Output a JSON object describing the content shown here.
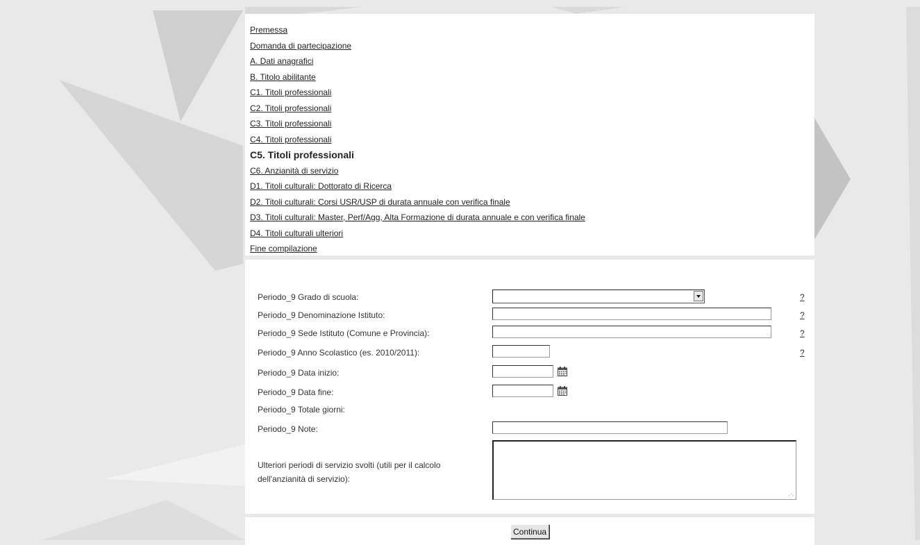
{
  "nav": {
    "items": [
      {
        "label": "Premessa"
      },
      {
        "label": "Domanda di partecipazione"
      },
      {
        "label": "A. Dati anagrafici"
      },
      {
        "label": "B. Titolo abilitante"
      },
      {
        "label": "C1. Titoli professionali"
      },
      {
        "label": "C2. Titoli professionali"
      },
      {
        "label": "C3. Titoli professionali"
      },
      {
        "label": "C4. Titoli professionali"
      },
      {
        "label": "C5. Titoli professionali"
      },
      {
        "label": "C6. Anzianità di servizio"
      },
      {
        "label": "D1. Titoli culturali: Dottorato di Ricerca"
      },
      {
        "label": "D2. Titoli culturali: Corsi USR/USP di durata annuale con verifica finale"
      },
      {
        "label": "D3. Titoli culturali: Master, Perf/Agg, Alta Formazione di durata annuale e con verifica finale"
      },
      {
        "label": "D4. Titoli culturali ulteriori"
      },
      {
        "label": "Fine compilazione"
      }
    ]
  },
  "form": {
    "grado": {
      "label": "Periodo_9 Grado di scuola:",
      "value": ""
    },
    "denominazione": {
      "label": "Periodo_9 Denominazione Istituto:",
      "value": ""
    },
    "sede": {
      "label": "Periodo_9 Sede Istituto (Comune e Provincia):",
      "value": ""
    },
    "anno": {
      "label": "Periodo_9 Anno Scolastico (es. 2010/2011):",
      "value": ""
    },
    "data_inizio": {
      "label": "Periodo_9 Data inizio:",
      "value": ""
    },
    "data_fine": {
      "label": "Periodo_9 Data fine:",
      "value": ""
    },
    "totale_giorni": {
      "label": "Periodo_9 Totale giorni:"
    },
    "note": {
      "label": "Periodo_9 Note:",
      "value": ""
    },
    "ulteriori": {
      "label": "Ulteriori periodi di servizio svolti (utili per il calcolo dell'anzianità di servizio):",
      "value": ""
    },
    "help_label": "?"
  },
  "actions": {
    "continue_label": "Continua"
  }
}
